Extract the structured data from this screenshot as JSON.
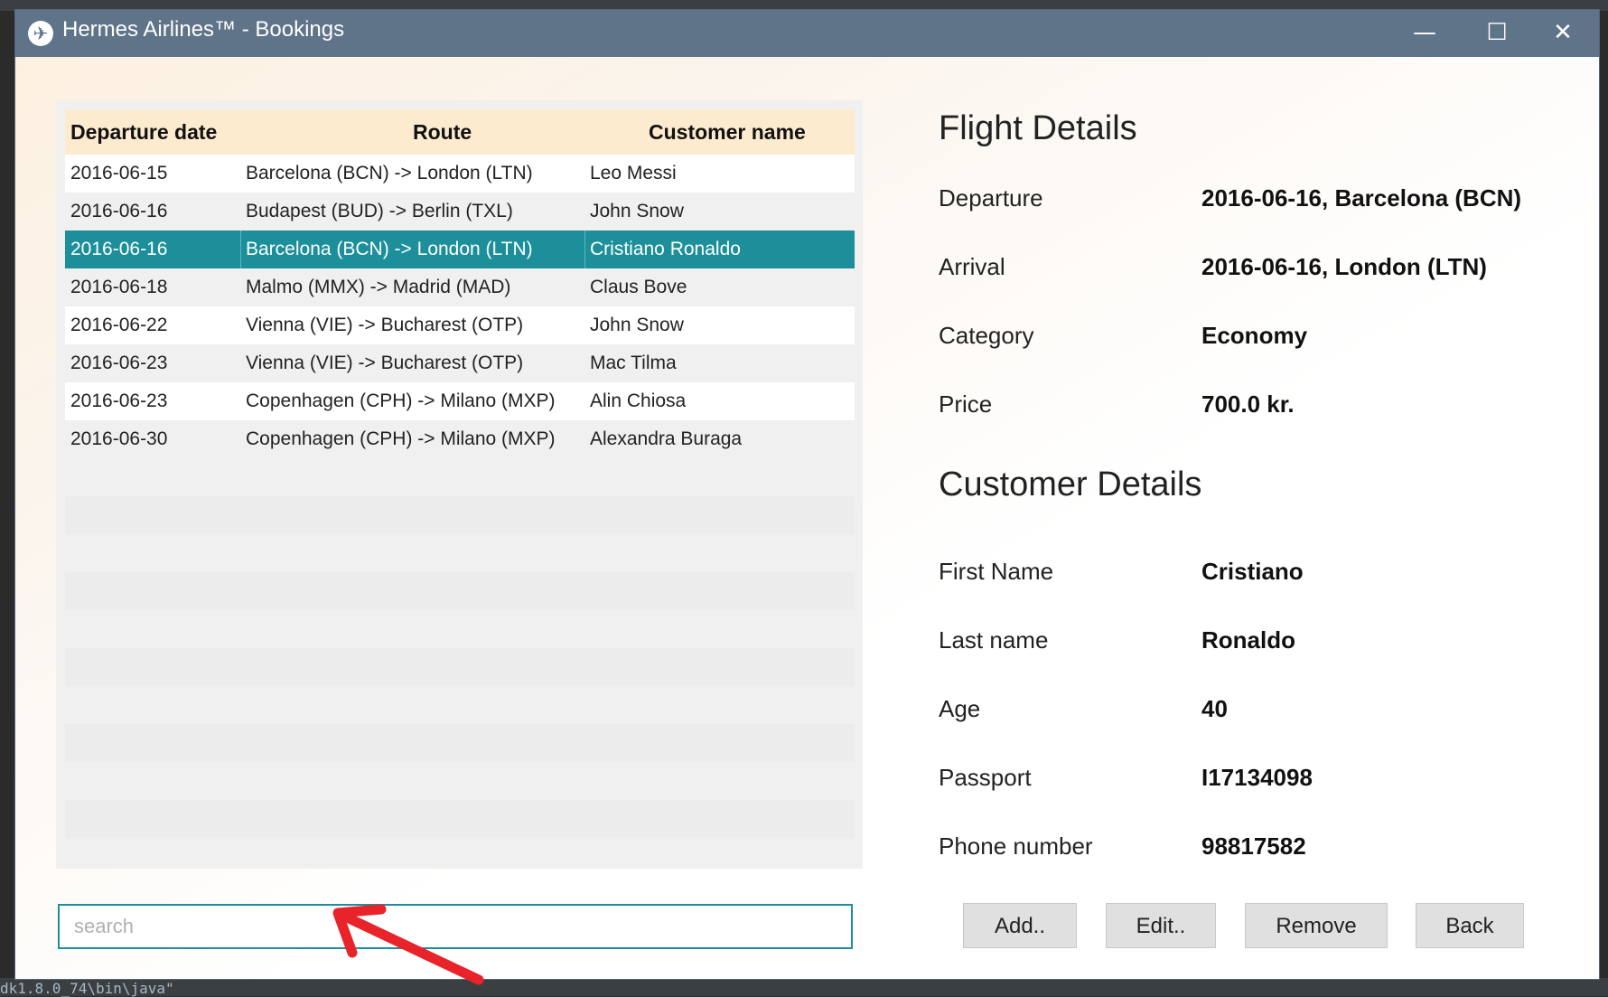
{
  "window": {
    "title": "Hermes Airlines™  -  Bookings",
    "controls": {
      "minimize": "—",
      "maximize": "☐",
      "close": "✕"
    }
  },
  "table": {
    "columns": [
      "Departure date",
      "Route",
      "Customer name"
    ],
    "rows": [
      {
        "date": "2016-06-15",
        "route": "Barcelona (BCN) -> London (LTN)",
        "customer": "Leo Messi"
      },
      {
        "date": "2016-06-16",
        "route": "Budapest (BUD) -> Berlin (TXL)",
        "customer": "John Snow"
      },
      {
        "date": "2016-06-16",
        "route": "Barcelona (BCN) -> London (LTN)",
        "customer": "Cristiano Ronaldo"
      },
      {
        "date": "2016-06-18",
        "route": "Malmo (MMX) -> Madrid (MAD)",
        "customer": "Claus Bove"
      },
      {
        "date": "2016-06-22",
        "route": "Vienna (VIE) -> Bucharest (OTP)",
        "customer": "John Snow"
      },
      {
        "date": "2016-06-23",
        "route": "Vienna (VIE) -> Bucharest (OTP)",
        "customer": "Mac Tilma"
      },
      {
        "date": "2016-06-23",
        "route": "Copenhagen (CPH) -> Milano (MXP)",
        "customer": "Alin Chiosa"
      },
      {
        "date": "2016-06-30",
        "route": "Copenhagen (CPH) -> Milano (MXP)",
        "customer": "Alexandra Buraga"
      }
    ],
    "selected_index": 2
  },
  "search": {
    "placeholder": "search",
    "value": ""
  },
  "flight_details": {
    "title": "Flight Details",
    "fields": [
      {
        "label": "Departure",
        "value": "2016-06-16, Barcelona (BCN)"
      },
      {
        "label": "Arrival",
        "value": "2016-06-16, London (LTN)"
      },
      {
        "label": "Category",
        "value": "Economy"
      },
      {
        "label": "Price",
        "value": "700.0 kr."
      }
    ]
  },
  "customer_details": {
    "title": "Customer Details",
    "fields": [
      {
        "label": "First Name",
        "value": "Cristiano"
      },
      {
        "label": "Last name",
        "value": "Ronaldo"
      },
      {
        "label": "Age",
        "value": "40"
      },
      {
        "label": "Passport",
        "value": "I17134098"
      },
      {
        "label": "Phone number",
        "value": "98817582"
      }
    ]
  },
  "buttons": {
    "add": "Add..",
    "edit": "Edit..",
    "remove": "Remove",
    "back": "Back"
  },
  "background": {
    "bottom_text": "dk1.8.0_74\\bin\\java\""
  },
  "colors": {
    "titlebar": "#5f7389",
    "selection": "#1c8f9a",
    "header": "#fdebcf",
    "annotation_arrow": "#e8232a"
  }
}
